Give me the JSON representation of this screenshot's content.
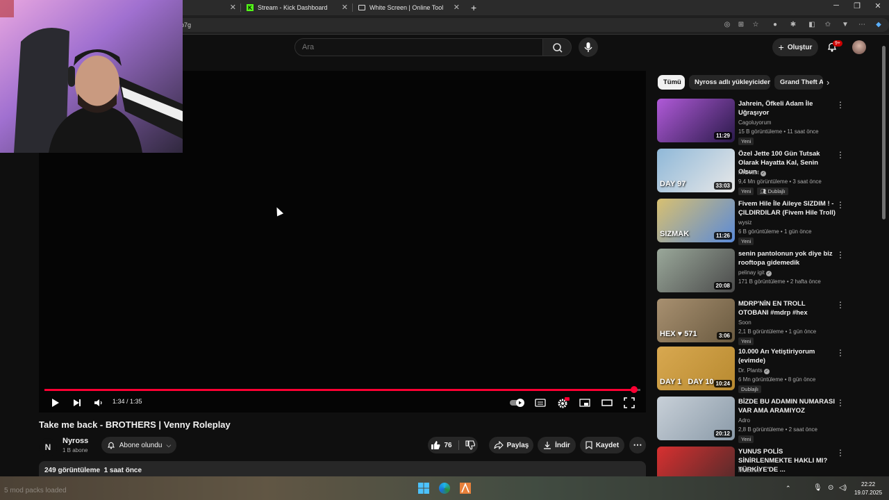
{
  "browser": {
    "tabs": [
      {
        "title": "Stream - Kick Dashboard",
        "icon": "kick-icon"
      },
      {
        "title": "White Screen | Online Tool",
        "icon": "page-icon"
      }
    ],
    "new_tab_label": "+",
    "url_fragment": "p7g"
  },
  "header": {
    "search_placeholder": "Ara",
    "create_label": "Oluştur",
    "notification_count": "9+"
  },
  "player": {
    "current_time": "1:34",
    "duration": "1:35",
    "time_display": "1:34 / 1:35",
    "progress_fraction": 0.989,
    "hd_badge": "HD"
  },
  "video": {
    "title": "Take me back - BROTHERS | Venny Roleplay",
    "channel_initial": "N",
    "channel_name": "Nyross",
    "subscribers": "1 B abone",
    "subscribe_label": "Abone olundu",
    "likes": "76",
    "share_label": "Paylaş",
    "download_label": "İndir",
    "save_label": "Kaydet",
    "views_line": "249 görüntüleme  1 saat önce"
  },
  "sidebar": {
    "chips": [
      "Tümü",
      "Nyross adlı yükleyiciden",
      "Grand Theft A"
    ],
    "recommendations": [
      {
        "title": "Jahrein, Öfkeli Adam İle Uğraşıyor",
        "channel": "Cagoluyorum",
        "verified": false,
        "meta": "15 B görüntüleme • 11 saat önce",
        "badges": [
          "Yeni"
        ],
        "duration": "11:29",
        "thumb_colors": [
          "#b05ad8",
          "#2a1a4a"
        ]
      },
      {
        "title": "Özel Jette 100 Gün Tutsak Olarak Hayatta Kal, Senin Olsun",
        "channel": "MrBeast",
        "verified": true,
        "meta": "9,4 Mn görüntüleme • 3 saat önce",
        "badges": [
          "Yeni",
          "Dublajlı"
        ],
        "duration": "33:03",
        "thumb_colors": [
          "#8fb8d8",
          "#e8e8e8"
        ],
        "thumb_text": "DAY 97"
      },
      {
        "title": "Fivem Hile İle Aileye SIZDIM ! - ÇILDIRDILAR (Fivem Hile Troll)",
        "channel": "wysiz",
        "verified": false,
        "meta": "6 B görüntüleme • 1 gün önce",
        "badges": [
          "Yeni"
        ],
        "duration": "11:26",
        "thumb_colors": [
          "#d8c070",
          "#5a8ad8"
        ],
        "thumb_text": "SIZMAK"
      },
      {
        "title": "senin pantolonun yok diye biz rooftopa gidemedik",
        "channel": "pelinay igit",
        "verified": true,
        "meta": "171 B görüntüleme • 2 hafta önce",
        "badges": [],
        "duration": "20:08",
        "thumb_colors": [
          "#9aa89a",
          "#4a4a4a"
        ]
      },
      {
        "title": "MDRP'NİN EN TROLL OTOBANI #mdrp  #hex",
        "channel": "Soon",
        "verified": false,
        "meta": "2,1 B görüntüleme • 1 gün önce",
        "badges": [
          "Yeni"
        ],
        "duration": "3:06",
        "thumb_colors": [
          "#a89070",
          "#6a5a40"
        ],
        "thumb_text": "HEX ♥ 571"
      },
      {
        "title": "10.000 Arı Yetiştiriyorum (evimde)",
        "channel": "Dr. Plants",
        "verified": true,
        "meta": "6 Mn görüntüleme • 8 gün önce",
        "badges": [
          "Dublajlı"
        ],
        "duration": "10:24",
        "thumb_colors": [
          "#d8a850",
          "#b88a30"
        ],
        "thumb_text": "DAY 1   DAY 10"
      },
      {
        "title": "BİZDE BU ADAMIN NUMARASI VAR AMA ARAMIYOZ",
        "channel": "Adro",
        "verified": false,
        "meta": "2,8 B görüntüleme • 2 saat önce",
        "badges": [
          "Yeni"
        ],
        "duration": "20:12",
        "thumb_colors": [
          "#c8d0d8",
          "#8a9aa8"
        ]
      },
      {
        "title": "YUNUS POLİS SİNİRLENMEKTE HAKLI MI? TÜRKİYE'DE ...",
        "channel": "Motofree",
        "verified": false,
        "meta": "",
        "badges": [],
        "duration": "",
        "thumb_colors": [
          "#d83030",
          "#4a2a2a"
        ]
      }
    ]
  },
  "taskbar": {
    "watermark_text": "5 mod packs loaded",
    "time": "22:22",
    "date": "19.07.2025"
  },
  "colors": {
    "accent_red": "#ff0033",
    "kick_green": "#53fc18",
    "background": "#0f0f0f"
  }
}
